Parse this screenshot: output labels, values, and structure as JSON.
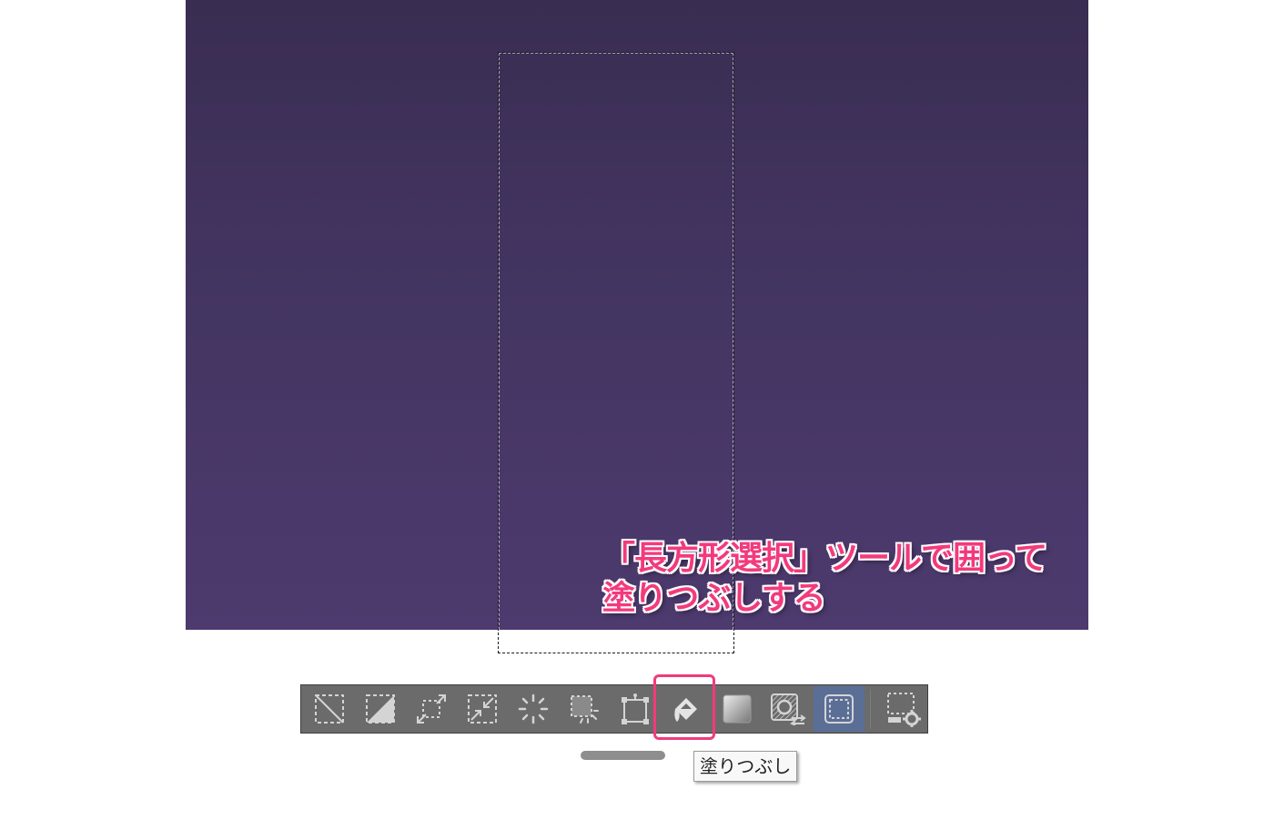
{
  "annotation": {
    "line1": "「長方形選択」ツールで囲って",
    "line2": "塗りつぶしする"
  },
  "tooltip": {
    "text": "塗りつぶし"
  },
  "toolbar": {
    "tools": [
      {
        "icon": "deselect-icon",
        "active": false
      },
      {
        "icon": "invert-selection-icon",
        "active": false
      },
      {
        "icon": "expand-selection-icon",
        "active": false
      },
      {
        "icon": "shrink-selection-icon",
        "active": false
      },
      {
        "icon": "blur-selection-icon",
        "active": false
      },
      {
        "icon": "clear-selection-icon",
        "active": false
      },
      {
        "icon": "transform-selection-icon",
        "active": false
      },
      {
        "icon": "paint-bucket-icon",
        "active": false,
        "highlighted": true
      },
      {
        "icon": "new-layer-from-selection-icon",
        "active": false
      },
      {
        "icon": "selection-layer-switch-icon",
        "active": false
      },
      {
        "icon": "show-selection-icon",
        "active": true
      },
      {
        "icon": "selection-settings-icon",
        "active": false
      }
    ]
  },
  "colors": {
    "canvas_top": "#3a2d52",
    "canvas_bottom": "#4d3a6e",
    "accent": "#f23a7c",
    "toolbar": "#6b6b6b",
    "active_tool": "#5a6e96"
  }
}
